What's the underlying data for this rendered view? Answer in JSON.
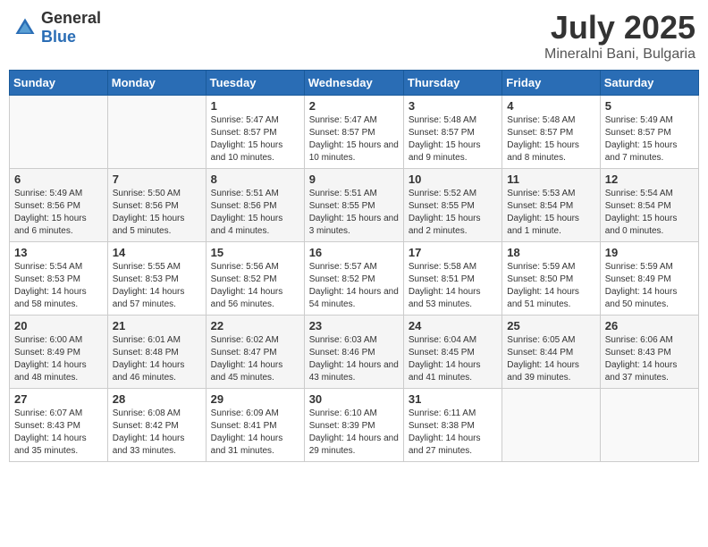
{
  "header": {
    "logo_general": "General",
    "logo_blue": "Blue",
    "title": "July 2025",
    "location": "Mineralni Bani, Bulgaria"
  },
  "weekdays": [
    "Sunday",
    "Monday",
    "Tuesday",
    "Wednesday",
    "Thursday",
    "Friday",
    "Saturday"
  ],
  "weeks": [
    [
      {
        "day": "",
        "sunrise": "",
        "sunset": "",
        "daylight": ""
      },
      {
        "day": "",
        "sunrise": "",
        "sunset": "",
        "daylight": ""
      },
      {
        "day": "1",
        "sunrise": "Sunrise: 5:47 AM",
        "sunset": "Sunset: 8:57 PM",
        "daylight": "Daylight: 15 hours and 10 minutes."
      },
      {
        "day": "2",
        "sunrise": "Sunrise: 5:47 AM",
        "sunset": "Sunset: 8:57 PM",
        "daylight": "Daylight: 15 hours and 10 minutes."
      },
      {
        "day": "3",
        "sunrise": "Sunrise: 5:48 AM",
        "sunset": "Sunset: 8:57 PM",
        "daylight": "Daylight: 15 hours and 9 minutes."
      },
      {
        "day": "4",
        "sunrise": "Sunrise: 5:48 AM",
        "sunset": "Sunset: 8:57 PM",
        "daylight": "Daylight: 15 hours and 8 minutes."
      },
      {
        "day": "5",
        "sunrise": "Sunrise: 5:49 AM",
        "sunset": "Sunset: 8:57 PM",
        "daylight": "Daylight: 15 hours and 7 minutes."
      }
    ],
    [
      {
        "day": "6",
        "sunrise": "Sunrise: 5:49 AM",
        "sunset": "Sunset: 8:56 PM",
        "daylight": "Daylight: 15 hours and 6 minutes."
      },
      {
        "day": "7",
        "sunrise": "Sunrise: 5:50 AM",
        "sunset": "Sunset: 8:56 PM",
        "daylight": "Daylight: 15 hours and 5 minutes."
      },
      {
        "day": "8",
        "sunrise": "Sunrise: 5:51 AM",
        "sunset": "Sunset: 8:56 PM",
        "daylight": "Daylight: 15 hours and 4 minutes."
      },
      {
        "day": "9",
        "sunrise": "Sunrise: 5:51 AM",
        "sunset": "Sunset: 8:55 PM",
        "daylight": "Daylight: 15 hours and 3 minutes."
      },
      {
        "day": "10",
        "sunrise": "Sunrise: 5:52 AM",
        "sunset": "Sunset: 8:55 PM",
        "daylight": "Daylight: 15 hours and 2 minutes."
      },
      {
        "day": "11",
        "sunrise": "Sunrise: 5:53 AM",
        "sunset": "Sunset: 8:54 PM",
        "daylight": "Daylight: 15 hours and 1 minute."
      },
      {
        "day": "12",
        "sunrise": "Sunrise: 5:54 AM",
        "sunset": "Sunset: 8:54 PM",
        "daylight": "Daylight: 15 hours and 0 minutes."
      }
    ],
    [
      {
        "day": "13",
        "sunrise": "Sunrise: 5:54 AM",
        "sunset": "Sunset: 8:53 PM",
        "daylight": "Daylight: 14 hours and 58 minutes."
      },
      {
        "day": "14",
        "sunrise": "Sunrise: 5:55 AM",
        "sunset": "Sunset: 8:53 PM",
        "daylight": "Daylight: 14 hours and 57 minutes."
      },
      {
        "day": "15",
        "sunrise": "Sunrise: 5:56 AM",
        "sunset": "Sunset: 8:52 PM",
        "daylight": "Daylight: 14 hours and 56 minutes."
      },
      {
        "day": "16",
        "sunrise": "Sunrise: 5:57 AM",
        "sunset": "Sunset: 8:52 PM",
        "daylight": "Daylight: 14 hours and 54 minutes."
      },
      {
        "day": "17",
        "sunrise": "Sunrise: 5:58 AM",
        "sunset": "Sunset: 8:51 PM",
        "daylight": "Daylight: 14 hours and 53 minutes."
      },
      {
        "day": "18",
        "sunrise": "Sunrise: 5:59 AM",
        "sunset": "Sunset: 8:50 PM",
        "daylight": "Daylight: 14 hours and 51 minutes."
      },
      {
        "day": "19",
        "sunrise": "Sunrise: 5:59 AM",
        "sunset": "Sunset: 8:49 PM",
        "daylight": "Daylight: 14 hours and 50 minutes."
      }
    ],
    [
      {
        "day": "20",
        "sunrise": "Sunrise: 6:00 AM",
        "sunset": "Sunset: 8:49 PM",
        "daylight": "Daylight: 14 hours and 48 minutes."
      },
      {
        "day": "21",
        "sunrise": "Sunrise: 6:01 AM",
        "sunset": "Sunset: 8:48 PM",
        "daylight": "Daylight: 14 hours and 46 minutes."
      },
      {
        "day": "22",
        "sunrise": "Sunrise: 6:02 AM",
        "sunset": "Sunset: 8:47 PM",
        "daylight": "Daylight: 14 hours and 45 minutes."
      },
      {
        "day": "23",
        "sunrise": "Sunrise: 6:03 AM",
        "sunset": "Sunset: 8:46 PM",
        "daylight": "Daylight: 14 hours and 43 minutes."
      },
      {
        "day": "24",
        "sunrise": "Sunrise: 6:04 AM",
        "sunset": "Sunset: 8:45 PM",
        "daylight": "Daylight: 14 hours and 41 minutes."
      },
      {
        "day": "25",
        "sunrise": "Sunrise: 6:05 AM",
        "sunset": "Sunset: 8:44 PM",
        "daylight": "Daylight: 14 hours and 39 minutes."
      },
      {
        "day": "26",
        "sunrise": "Sunrise: 6:06 AM",
        "sunset": "Sunset: 8:43 PM",
        "daylight": "Daylight: 14 hours and 37 minutes."
      }
    ],
    [
      {
        "day": "27",
        "sunrise": "Sunrise: 6:07 AM",
        "sunset": "Sunset: 8:43 PM",
        "daylight": "Daylight: 14 hours and 35 minutes."
      },
      {
        "day": "28",
        "sunrise": "Sunrise: 6:08 AM",
        "sunset": "Sunset: 8:42 PM",
        "daylight": "Daylight: 14 hours and 33 minutes."
      },
      {
        "day": "29",
        "sunrise": "Sunrise: 6:09 AM",
        "sunset": "Sunset: 8:41 PM",
        "daylight": "Daylight: 14 hours and 31 minutes."
      },
      {
        "day": "30",
        "sunrise": "Sunrise: 6:10 AM",
        "sunset": "Sunset: 8:39 PM",
        "daylight": "Daylight: 14 hours and 29 minutes."
      },
      {
        "day": "31",
        "sunrise": "Sunrise: 6:11 AM",
        "sunset": "Sunset: 8:38 PM",
        "daylight": "Daylight: 14 hours and 27 minutes."
      },
      {
        "day": "",
        "sunrise": "",
        "sunset": "",
        "daylight": ""
      },
      {
        "day": "",
        "sunrise": "",
        "sunset": "",
        "daylight": ""
      }
    ]
  ]
}
